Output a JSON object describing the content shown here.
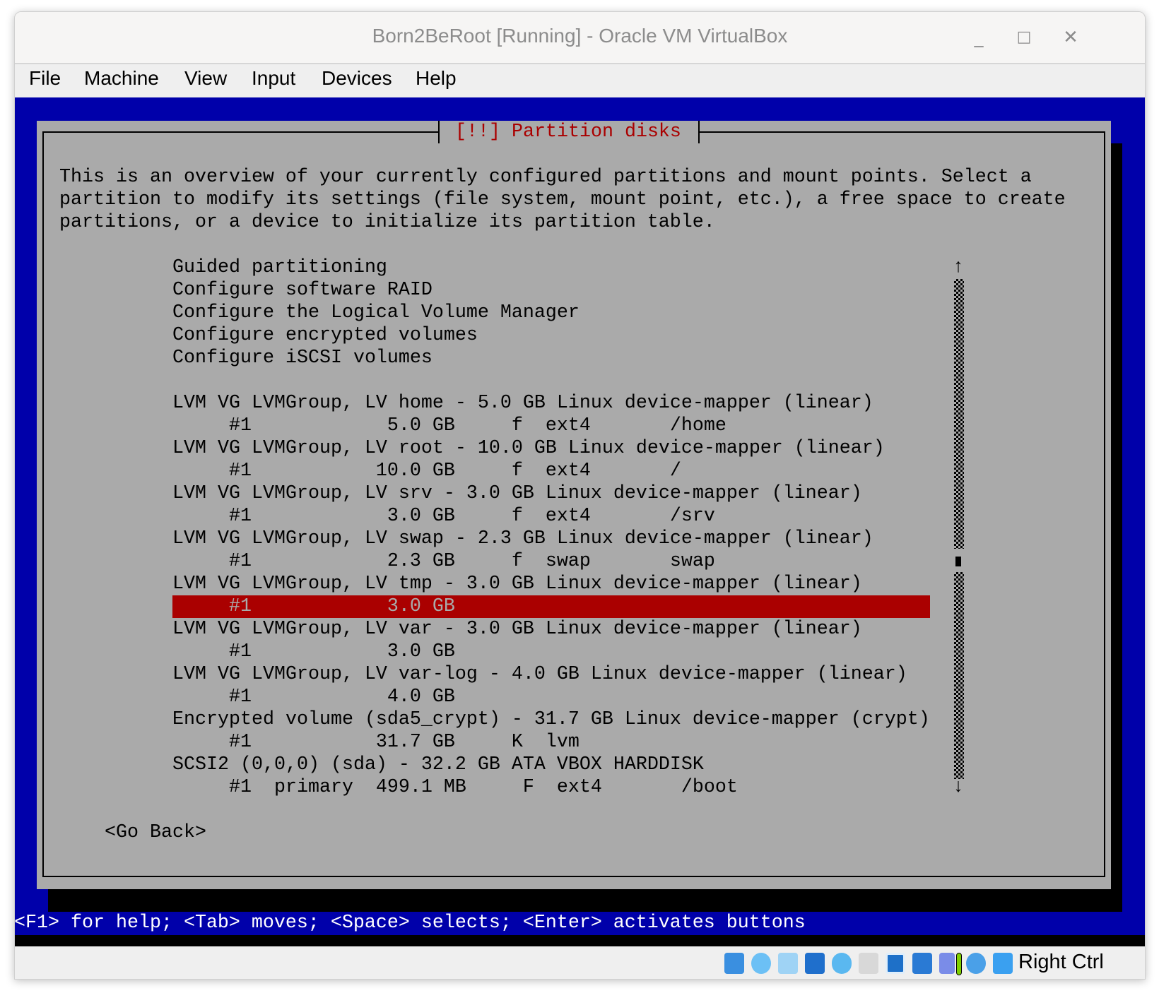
{
  "window": {
    "title": "Born2BeRoot [Running] - Oracle VM VirtualBox",
    "minimize": "_",
    "maximize": "□",
    "close": "✕"
  },
  "menu": [
    "File",
    "Machine",
    "View",
    "Input",
    "Devices",
    "Help"
  ],
  "installer": {
    "dialog_title": "[!!] Partition disks",
    "description": [
      "This is an overview of your currently configured partitions and mount points. Select a",
      "partition to modify its settings (file system, mount point, etc.), a free space to create",
      "partitions, or a device to initialize its partition table."
    ],
    "options": [
      "Guided partitioning",
      "Configure software RAID",
      "Configure the Logical Volume Manager",
      "Configure encrypted volumes",
      "Configure iSCSI volumes"
    ],
    "partitions": [
      "LVM VG LVMGroup, LV home - 5.0 GB Linux device-mapper (linear)",
      "     #1            5.0 GB     f  ext4       /home",
      "LVM VG LVMGroup, LV root - 10.0 GB Linux device-mapper (linear)",
      "     #1           10.0 GB     f  ext4       /",
      "LVM VG LVMGroup, LV srv - 3.0 GB Linux device-mapper (linear)",
      "     #1            3.0 GB     f  ext4       /srv",
      "LVM VG LVMGroup, LV swap - 2.3 GB Linux device-mapper (linear)",
      "     #1            2.3 GB     f  swap       swap",
      "LVM VG LVMGroup, LV tmp - 3.0 GB Linux device-mapper (linear)",
      "     #1            3.0 GB",
      "LVM VG LVMGroup, LV var - 3.0 GB Linux device-mapper (linear)",
      "     #1            3.0 GB",
      "LVM VG LVMGroup, LV var-log - 4.0 GB Linux device-mapper (linear)",
      "     #1            4.0 GB",
      "Encrypted volume (sda5_crypt) - 31.7 GB Linux device-mapper (crypt)",
      "     #1           31.7 GB     K  lvm",
      "SCSI2 (0,0,0) (sda) - 32.2 GB ATA VBOX HARDDISK",
      "     #1  primary  499.1 MB     F  ext4       /boot"
    ],
    "selected_index": 9,
    "scroll_up": "↑",
    "scroll_down": "↓",
    "go_back": "<Go Back>",
    "help_line": "<F1> for help; <Tab> moves; <Space> selects; <Enter> activates buttons"
  },
  "statusbar": {
    "icons": [
      "hard-disk-icon",
      "optical-drive-icon",
      "audio-icon",
      "network-icon",
      "usb-icon",
      "shared-folders-icon",
      "display-icon",
      "video-capture-icon",
      "cpu-activity-icon",
      "guest-additions-icon",
      "keyboard-capture-icon"
    ],
    "host_key": "Right Ctrl"
  },
  "colors": {
    "console_blue": "#0000aa",
    "dialog_gray": "#aaaaaa",
    "highlight_red": "#aa0000"
  }
}
